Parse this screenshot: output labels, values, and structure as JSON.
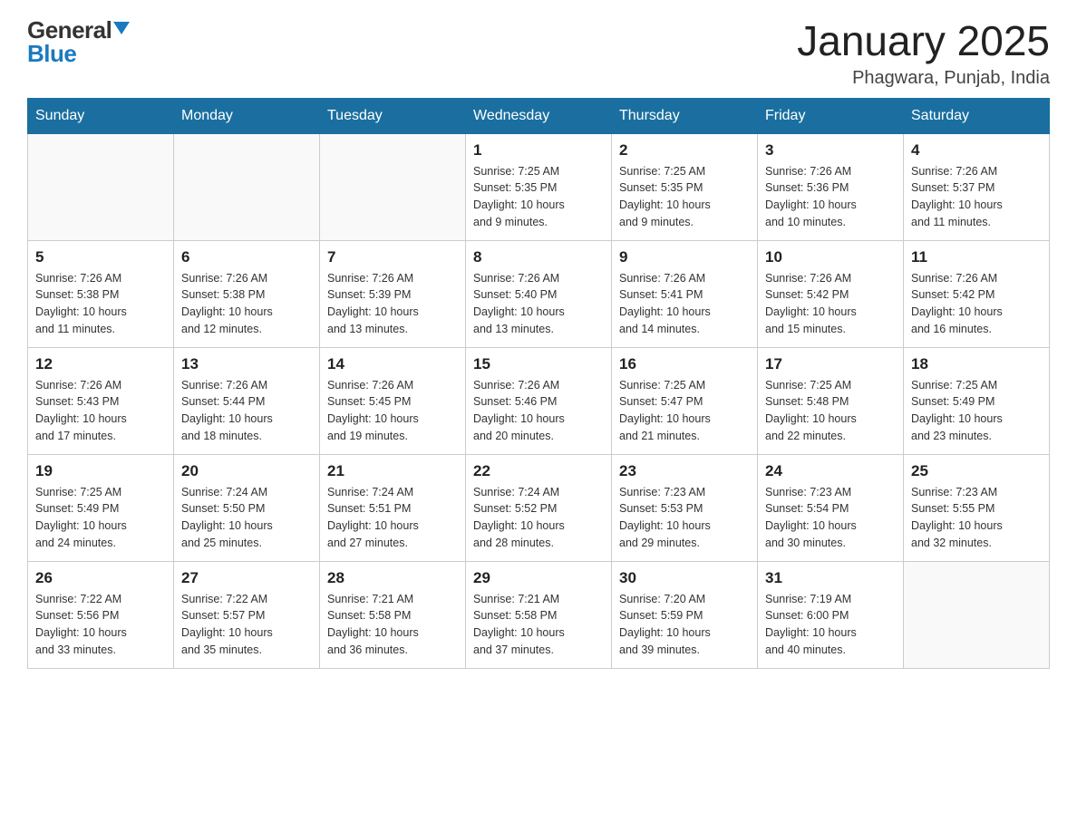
{
  "header": {
    "logo_general": "General",
    "logo_blue": "Blue",
    "month_year": "January 2025",
    "location": "Phagwara, Punjab, India"
  },
  "columns": [
    "Sunday",
    "Monday",
    "Tuesday",
    "Wednesday",
    "Thursday",
    "Friday",
    "Saturday"
  ],
  "weeks": [
    [
      {
        "day": "",
        "info": ""
      },
      {
        "day": "",
        "info": ""
      },
      {
        "day": "",
        "info": ""
      },
      {
        "day": "1",
        "info": "Sunrise: 7:25 AM\nSunset: 5:35 PM\nDaylight: 10 hours\nand 9 minutes."
      },
      {
        "day": "2",
        "info": "Sunrise: 7:25 AM\nSunset: 5:35 PM\nDaylight: 10 hours\nand 9 minutes."
      },
      {
        "day": "3",
        "info": "Sunrise: 7:26 AM\nSunset: 5:36 PM\nDaylight: 10 hours\nand 10 minutes."
      },
      {
        "day": "4",
        "info": "Sunrise: 7:26 AM\nSunset: 5:37 PM\nDaylight: 10 hours\nand 11 minutes."
      }
    ],
    [
      {
        "day": "5",
        "info": "Sunrise: 7:26 AM\nSunset: 5:38 PM\nDaylight: 10 hours\nand 11 minutes."
      },
      {
        "day": "6",
        "info": "Sunrise: 7:26 AM\nSunset: 5:38 PM\nDaylight: 10 hours\nand 12 minutes."
      },
      {
        "day": "7",
        "info": "Sunrise: 7:26 AM\nSunset: 5:39 PM\nDaylight: 10 hours\nand 13 minutes."
      },
      {
        "day": "8",
        "info": "Sunrise: 7:26 AM\nSunset: 5:40 PM\nDaylight: 10 hours\nand 13 minutes."
      },
      {
        "day": "9",
        "info": "Sunrise: 7:26 AM\nSunset: 5:41 PM\nDaylight: 10 hours\nand 14 minutes."
      },
      {
        "day": "10",
        "info": "Sunrise: 7:26 AM\nSunset: 5:42 PM\nDaylight: 10 hours\nand 15 minutes."
      },
      {
        "day": "11",
        "info": "Sunrise: 7:26 AM\nSunset: 5:42 PM\nDaylight: 10 hours\nand 16 minutes."
      }
    ],
    [
      {
        "day": "12",
        "info": "Sunrise: 7:26 AM\nSunset: 5:43 PM\nDaylight: 10 hours\nand 17 minutes."
      },
      {
        "day": "13",
        "info": "Sunrise: 7:26 AM\nSunset: 5:44 PM\nDaylight: 10 hours\nand 18 minutes."
      },
      {
        "day": "14",
        "info": "Sunrise: 7:26 AM\nSunset: 5:45 PM\nDaylight: 10 hours\nand 19 minutes."
      },
      {
        "day": "15",
        "info": "Sunrise: 7:26 AM\nSunset: 5:46 PM\nDaylight: 10 hours\nand 20 minutes."
      },
      {
        "day": "16",
        "info": "Sunrise: 7:25 AM\nSunset: 5:47 PM\nDaylight: 10 hours\nand 21 minutes."
      },
      {
        "day": "17",
        "info": "Sunrise: 7:25 AM\nSunset: 5:48 PM\nDaylight: 10 hours\nand 22 minutes."
      },
      {
        "day": "18",
        "info": "Sunrise: 7:25 AM\nSunset: 5:49 PM\nDaylight: 10 hours\nand 23 minutes."
      }
    ],
    [
      {
        "day": "19",
        "info": "Sunrise: 7:25 AM\nSunset: 5:49 PM\nDaylight: 10 hours\nand 24 minutes."
      },
      {
        "day": "20",
        "info": "Sunrise: 7:24 AM\nSunset: 5:50 PM\nDaylight: 10 hours\nand 25 minutes."
      },
      {
        "day": "21",
        "info": "Sunrise: 7:24 AM\nSunset: 5:51 PM\nDaylight: 10 hours\nand 27 minutes."
      },
      {
        "day": "22",
        "info": "Sunrise: 7:24 AM\nSunset: 5:52 PM\nDaylight: 10 hours\nand 28 minutes."
      },
      {
        "day": "23",
        "info": "Sunrise: 7:23 AM\nSunset: 5:53 PM\nDaylight: 10 hours\nand 29 minutes."
      },
      {
        "day": "24",
        "info": "Sunrise: 7:23 AM\nSunset: 5:54 PM\nDaylight: 10 hours\nand 30 minutes."
      },
      {
        "day": "25",
        "info": "Sunrise: 7:23 AM\nSunset: 5:55 PM\nDaylight: 10 hours\nand 32 minutes."
      }
    ],
    [
      {
        "day": "26",
        "info": "Sunrise: 7:22 AM\nSunset: 5:56 PM\nDaylight: 10 hours\nand 33 minutes."
      },
      {
        "day": "27",
        "info": "Sunrise: 7:22 AM\nSunset: 5:57 PM\nDaylight: 10 hours\nand 35 minutes."
      },
      {
        "day": "28",
        "info": "Sunrise: 7:21 AM\nSunset: 5:58 PM\nDaylight: 10 hours\nand 36 minutes."
      },
      {
        "day": "29",
        "info": "Sunrise: 7:21 AM\nSunset: 5:58 PM\nDaylight: 10 hours\nand 37 minutes."
      },
      {
        "day": "30",
        "info": "Sunrise: 7:20 AM\nSunset: 5:59 PM\nDaylight: 10 hours\nand 39 minutes."
      },
      {
        "day": "31",
        "info": "Sunrise: 7:19 AM\nSunset: 6:00 PM\nDaylight: 10 hours\nand 40 minutes."
      },
      {
        "day": "",
        "info": ""
      }
    ]
  ]
}
